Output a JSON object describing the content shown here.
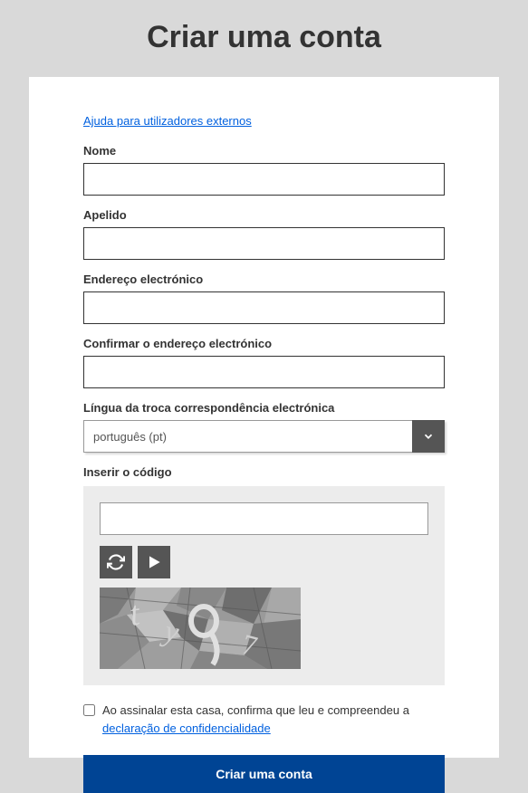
{
  "title": "Criar uma conta",
  "help_link": "Ajuda para utilizadores externos",
  "fields": {
    "nome": {
      "label": "Nome",
      "value": ""
    },
    "apelido": {
      "label": "Apelido",
      "value": ""
    },
    "email": {
      "label": "Endereço electrónico",
      "value": ""
    },
    "email_confirm": {
      "label": "Confirmar o endereço electrónico",
      "value": ""
    },
    "lingua": {
      "label": "Língua da troca correspondência electrónica",
      "selected": "português (pt)"
    },
    "codigo": {
      "label": "Inserir o código",
      "value": ""
    }
  },
  "consent": {
    "prefix": "Ao assinalar esta casa, confirma que leu e compreendeu a ",
    "link": "declaração de confidencialidade"
  },
  "submit": "Criar uma conta"
}
